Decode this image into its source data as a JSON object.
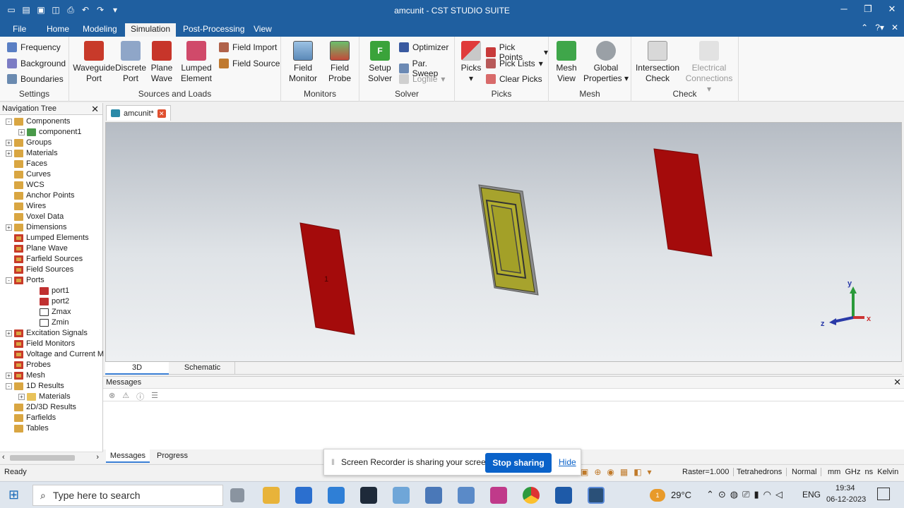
{
  "app": {
    "title": "amcunit - CST STUDIO SUITE"
  },
  "menu": {
    "tabs": [
      "File",
      "Home",
      "Modeling",
      "Simulation",
      "Post-Processing",
      "View"
    ],
    "active": "Simulation"
  },
  "ribbon": {
    "settings": {
      "label": "Settings",
      "frequency": "Frequency",
      "background": "Background",
      "boundaries": "Boundaries"
    },
    "sources": {
      "label": "Sources and Loads",
      "waveguide_port": [
        "Waveguide",
        "Port"
      ],
      "discrete_port": [
        "Discrete",
        "Port"
      ],
      "plane_wave": [
        "Plane",
        "Wave"
      ],
      "lumped_element": [
        "Lumped",
        "Element"
      ],
      "field_import": "Field Import",
      "field_source": "Field Source"
    },
    "monitors": {
      "label": "Monitors",
      "field_monitor": [
        "Field",
        "Monitor"
      ],
      "field_probe": [
        "Field",
        "Probe"
      ]
    },
    "solver": {
      "label": "Solver",
      "setup_solver": [
        "Setup",
        "Solver"
      ],
      "optimizer": "Optimizer",
      "par_sweep": "Par. Sweep",
      "logfile": "Logfile"
    },
    "picks": {
      "label": "Picks",
      "picks": "Picks",
      "pick_points": "Pick Points",
      "pick_lists": "Pick Lists",
      "clear_picks": "Clear Picks"
    },
    "mesh": {
      "label": "Mesh",
      "mesh_view": [
        "Mesh",
        "View"
      ],
      "global_properties": [
        "Global",
        "Properties"
      ]
    },
    "check": {
      "label": "Check",
      "intersection_check": [
        "Intersection",
        "Check"
      ],
      "electrical_connections": [
        "Electrical",
        "Connections"
      ]
    }
  },
  "nav": {
    "title": "Navigation Tree",
    "items": [
      {
        "label": "Components",
        "indent": 0,
        "exp": "-",
        "icon": "folder"
      },
      {
        "label": "component1",
        "indent": 1,
        "exp": "+",
        "icon": "component"
      },
      {
        "label": "Groups",
        "indent": 0,
        "exp": "+",
        "icon": "folder"
      },
      {
        "label": "Materials",
        "indent": 0,
        "exp": "+",
        "icon": "folder"
      },
      {
        "label": "Faces",
        "indent": 0,
        "exp": "",
        "icon": "folder"
      },
      {
        "label": "Curves",
        "indent": 0,
        "exp": "",
        "icon": "folder"
      },
      {
        "label": "WCS",
        "indent": 0,
        "exp": "",
        "icon": "folder"
      },
      {
        "label": "Anchor Points",
        "indent": 0,
        "exp": "",
        "icon": "folder"
      },
      {
        "label": "Wires",
        "indent": 0,
        "exp": "",
        "icon": "folder"
      },
      {
        "label": "Voxel Data",
        "indent": 0,
        "exp": "",
        "icon": "folder"
      },
      {
        "label": "Dimensions",
        "indent": 0,
        "exp": "+",
        "icon": "folder"
      },
      {
        "label": "Lumped Elements",
        "indent": 0,
        "exp": "",
        "icon": "folder-red"
      },
      {
        "label": "Plane Wave",
        "indent": 0,
        "exp": "",
        "icon": "folder-red"
      },
      {
        "label": "Farfield Sources",
        "indent": 0,
        "exp": "",
        "icon": "folder-red"
      },
      {
        "label": "Field Sources",
        "indent": 0,
        "exp": "",
        "icon": "folder-red"
      },
      {
        "label": "Ports",
        "indent": 0,
        "exp": "-",
        "icon": "folder-red"
      },
      {
        "label": "port1",
        "indent": 2,
        "exp": "",
        "icon": "port"
      },
      {
        "label": "port2",
        "indent": 2,
        "exp": "",
        "icon": "port"
      },
      {
        "label": "Zmax",
        "indent": 2,
        "exp": "",
        "icon": "boundary"
      },
      {
        "label": "Zmin",
        "indent": 2,
        "exp": "",
        "icon": "boundary"
      },
      {
        "label": "Excitation Signals",
        "indent": 0,
        "exp": "+",
        "icon": "folder-red"
      },
      {
        "label": "Field Monitors",
        "indent": 0,
        "exp": "",
        "icon": "folder-red"
      },
      {
        "label": "Voltage and Current M",
        "indent": 0,
        "exp": "",
        "icon": "folder-red"
      },
      {
        "label": "Probes",
        "indent": 0,
        "exp": "",
        "icon": "folder-red"
      },
      {
        "label": "Mesh",
        "indent": 0,
        "exp": "+",
        "icon": "folder-red"
      },
      {
        "label": "1D Results",
        "indent": 0,
        "exp": "-",
        "icon": "folder"
      },
      {
        "label": "Materials",
        "indent": 1,
        "exp": "+",
        "icon": "folder-plain"
      },
      {
        "label": "2D/3D Results",
        "indent": 0,
        "exp": "",
        "icon": "folder"
      },
      {
        "label": "Farfields",
        "indent": 0,
        "exp": "",
        "icon": "folder"
      },
      {
        "label": "Tables",
        "indent": 0,
        "exp": "",
        "icon": "folder"
      }
    ]
  },
  "doc": {
    "tab": "amcunit*"
  },
  "viewport": {
    "axis_x": "x",
    "axis_y": "y",
    "axis_z": "z",
    "port_label": "1"
  },
  "view_tabs": [
    "3D",
    "Schematic"
  ],
  "messages": {
    "title": "Messages"
  },
  "bottom_tabs": [
    "Messages",
    "Progress"
  ],
  "status": {
    "left": "Ready",
    "raster": "Raster=1.000",
    "mesh": "Tetrahedrons",
    "mode": "Normal",
    "units": "mm  GHz  ns  Kelvin"
  },
  "toast": {
    "text": "Screen Recorder is sharing your screen.",
    "stop": "Stop sharing",
    "hide": "Hide"
  },
  "taskbar": {
    "search": "Type here to search",
    "weather": "29°C",
    "lang": "ENG",
    "time": "19:34",
    "date": "06-12-2023",
    "notif": "1"
  },
  "colors": {
    "titlebar": "#1f5fa0",
    "port_red": "#a40b0b",
    "patch": "#a9a62c",
    "accent": "#0a62c9"
  }
}
